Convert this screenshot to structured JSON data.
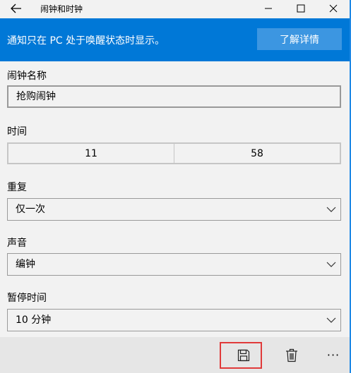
{
  "window": {
    "title": "闹钟和时钟",
    "back_icon": "back-arrow-icon",
    "minimize_icon": "minimize-icon",
    "maximize_icon": "maximize-icon",
    "close_icon": "close-icon"
  },
  "banner": {
    "text": "通知只在 PC 处于唤醒状态时显示。",
    "button_label": "了解详情",
    "background_color": "#0078d7"
  },
  "form": {
    "alarm_name": {
      "label": "闹钟名称",
      "value": "抢购闹钟"
    },
    "time": {
      "label": "时间",
      "hour": "11",
      "minute": "58"
    },
    "repeat": {
      "label": "重复",
      "value": "仅一次"
    },
    "sound": {
      "label": "声音",
      "value": "编钟"
    },
    "snooze": {
      "label": "暂停时间",
      "value": "10 分钟"
    }
  },
  "command_bar": {
    "save_icon": "save-icon",
    "delete_icon": "delete-icon",
    "more_label": "···",
    "highlight_color": "#e03a3a"
  }
}
